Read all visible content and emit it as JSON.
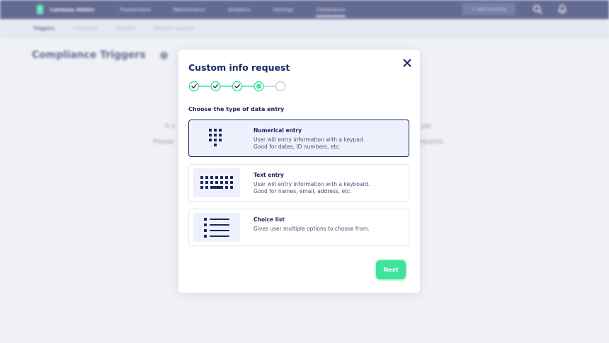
{
  "background": {
    "brand": "Lamassu Admin",
    "nav": [
      "Transactions",
      "Maintenance",
      "Analytics",
      "Settings",
      "Compliance"
    ],
    "active_nav": "Compliance",
    "add_machine": "+ Add machine",
    "subnav": [
      "Triggers",
      "Customers",
      "Blacklist",
      "Discount coupons"
    ],
    "active_subnav": "Triggers",
    "page_title": "Compliance Triggers"
  },
  "modal": {
    "title": "Custom info request",
    "steps": {
      "total": 5,
      "completed": 3,
      "current": 4
    },
    "section_label": "Choose the type of data entry",
    "options": [
      {
        "title": "Numerical entry",
        "description": "User will entry information with a keypad.\nGood for dates, ID numbers, etc.",
        "icon": "keypad-icon",
        "selected": true
      },
      {
        "title": "Text entry",
        "description": "User will entry information with a keyboard.\nGood for names, email, address, etc.",
        "icon": "keyboard-icon",
        "selected": false
      },
      {
        "title": "Choice list",
        "description": "Gives user multiple options to choose from.",
        "icon": "list-icon",
        "selected": false
      }
    ],
    "next_label": "Next"
  },
  "colors": {
    "navy": "#1c2762",
    "accent_green": "#3fe39c",
    "selected_bg": "#eef0fb"
  }
}
